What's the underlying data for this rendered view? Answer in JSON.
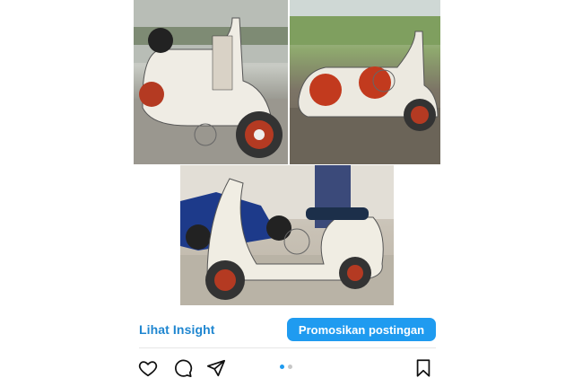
{
  "post": {
    "images": [
      {
        "alt_icon": "scooter-photo"
      },
      {
        "alt_icon": "scooter-photo"
      },
      {
        "alt_icon": "scooter-photo"
      }
    ],
    "insight_label": "Lihat Insight",
    "promote_label": "Promosikan postingan"
  },
  "actions": {
    "like_icon": "heart-icon",
    "comment_icon": "comment-icon",
    "share_icon": "send-icon",
    "save_icon": "bookmark-icon"
  },
  "carousel": {
    "total": 2,
    "active_index": 0
  },
  "colors": {
    "accent": "#1f9bf0",
    "link": "#1f86d0"
  }
}
